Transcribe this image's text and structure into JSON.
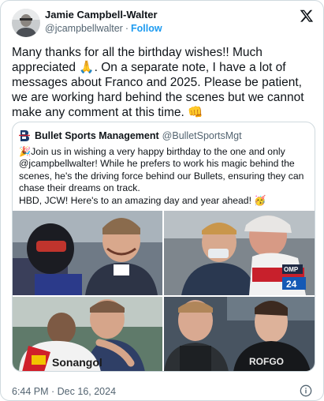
{
  "author": {
    "name": "Jamie Campbell-Walter",
    "handle": "@jcampbellwalter",
    "separator": "·",
    "follow_label": "Follow"
  },
  "tweet": {
    "text": "Many thanks for all the birthday wishes!! Much appreciated 🙏. On a separate note, I have a lot of messages about Franco and 2025. Please be patient, we are working hard behind the scenes but we cannot make any comment at this time. 👊"
  },
  "quoted_tweet": {
    "author_name": "Bullet Sports Management",
    "author_handle": "@BulletSportsMgt",
    "logo_letter": "B",
    "paragraph_1": "🎉Join us in wishing a very happy birthday to the one and only @jcampbellwalter! While he prefers to work his magic behind the scenes, he's the driving force behind our Bullets, ensuring they can chase their dreams on track.",
    "paragraph_2": "HBD, JCW! Here's to an amazing day and year ahead! 🥳",
    "photo_texts": {
      "helmet_brand": "OMP",
      "car_number": "24",
      "shirt_brand": "Sonangol",
      "suit_brand": "ROFGO"
    }
  },
  "footer": {
    "timestamp": "6:44 PM · Dec 16, 2024"
  },
  "colors": {
    "accent": "#1d9bf0",
    "secondary_text": "#536471",
    "border": "#cfd9de"
  },
  "icons": [
    "x-logo-icon",
    "info-icon",
    "bullet-logo-icon"
  ]
}
